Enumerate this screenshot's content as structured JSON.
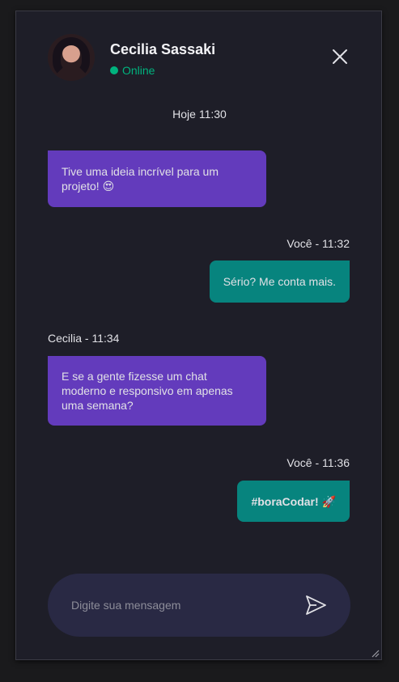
{
  "header": {
    "name": "Cecilia Sassaki",
    "status": "Online",
    "avatar_icon": "profile-photo",
    "close_icon": "close-icon"
  },
  "date_separator": "Hoje 11:30",
  "messages": [
    {
      "direction": "received",
      "meta": "",
      "text": "Tive uma ideia incrível para um projeto! 😍"
    },
    {
      "direction": "sent",
      "meta": "Você - 11:32",
      "text": "Sério? Me conta mais."
    },
    {
      "direction": "received",
      "meta": "Cecilia - 11:34",
      "text": "E se a gente fizesse um chat moderno e responsivo em apenas uma semana?"
    },
    {
      "direction": "sent",
      "meta": "Você - 11:36",
      "text": "#boraCodar! 🚀"
    }
  ],
  "composer": {
    "placeholder": "Digite sua mensagem",
    "value": "",
    "send_icon": "send-icon"
  },
  "colors": {
    "background": "#1e1e28",
    "received_bubble": "#633bbc",
    "sent_bubble": "#07847e",
    "online": "#00b37e",
    "composer": "#292944"
  }
}
